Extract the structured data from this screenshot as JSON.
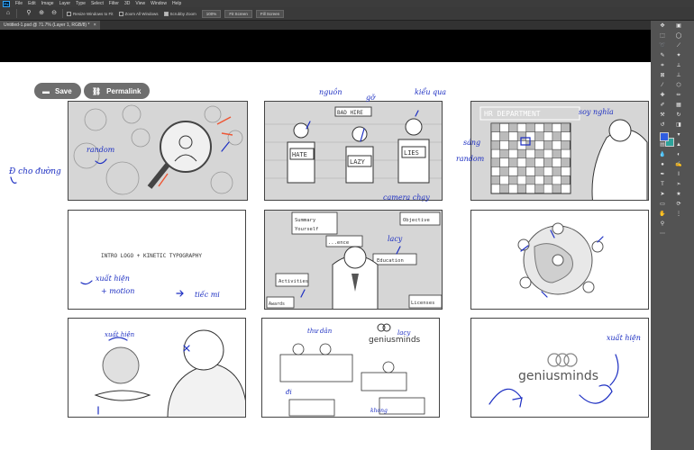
{
  "menubar": {
    "logo": "Ps",
    "items": [
      "File",
      "Edit",
      "Image",
      "Layer",
      "Type",
      "Select",
      "Filter",
      "3D",
      "View",
      "Window",
      "Help"
    ]
  },
  "optionsbar": {
    "checks": [
      "Resize Windows to Fit",
      "Zoom All Windows",
      "Scrubby Zoom"
    ],
    "buttons": [
      "100%",
      "Fit Screen",
      "Fill Screen"
    ]
  },
  "document_tab": {
    "title": "Untitled-1.psd @ 71.7% (Layer 1, RGB/8) *",
    "close": "×"
  },
  "toolbar": {
    "save_label": "Save",
    "permalink_label": "Permalink"
  },
  "colors": {
    "foreground": "#2f5de0",
    "background": "#2ea39a",
    "annotation_ink": "#1d2fc2"
  },
  "annotations": {
    "side_note": "Đ cho đường",
    "f1_random": "random",
    "f2_top1": "nguồn",
    "f2_top2": "gỡ",
    "f2_top3": "kiểu qua",
    "f2_bottom": "camera chạy",
    "f3_top": "soy nghĩa",
    "f3_left1": "sáng",
    "f3_left2": "random",
    "f4_note1": "xuất hiện",
    "f4_note2": "+ motion",
    "f4_note3": "tiếc mi",
    "f5_note": "lacy",
    "f7_note": "xuất hiện",
    "f8_note1": "thư dân",
    "f8_note2": "đi",
    "f8_note3": "lacy",
    "f8_note4": "khong",
    "f9_note": "xuất hiện"
  },
  "frames": {
    "f2_sign": "BAD HIRE",
    "f2_card1": "HATE",
    "f2_card2": "LAZY",
    "f2_card3": "LIES",
    "f3_sign": "HR DEPARTMENT",
    "f4_text": "INTRO LOGO + KINETIC TYPOGRAPHY",
    "f5_labels": [
      "Summary",
      "Yourself",
      "...ence",
      "Objective",
      "Education",
      "Activities",
      "Licenses",
      "Awards"
    ],
    "f8_brand": "geniusminds",
    "f9_brand": "geniusminds"
  }
}
